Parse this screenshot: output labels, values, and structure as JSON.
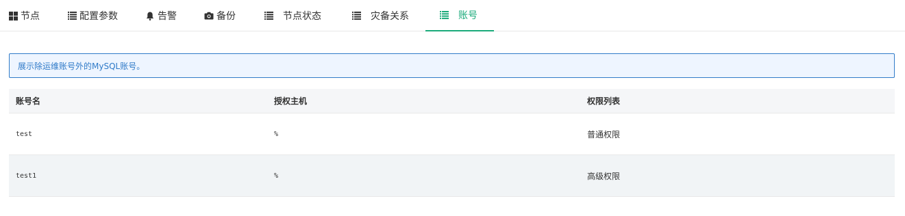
{
  "tabs": [
    {
      "label": "节点",
      "icon": "grid-icon",
      "active": false
    },
    {
      "label": "配置参数",
      "icon": "list-icon",
      "active": false
    },
    {
      "label": "告警",
      "icon": "bell-icon",
      "active": false
    },
    {
      "label": "备份",
      "icon": "camera-icon",
      "active": false
    },
    {
      "label": "节点状态",
      "icon": "list-icon",
      "active": false
    },
    {
      "label": "灾备关系",
      "icon": "list-icon",
      "active": false
    },
    {
      "label": "账号",
      "icon": "list-icon",
      "active": true
    }
  ],
  "notice": "展示除运维账号外的MySQL账号。",
  "table": {
    "headers": [
      "账号名",
      "授权主机",
      "权限列表"
    ],
    "rows": [
      {
        "account": "test",
        "host": "%",
        "privileges": "普通权限"
      },
      {
        "account": "test1",
        "host": "%",
        "privileges": "高级权限"
      }
    ]
  },
  "colors": {
    "accent": "#1aaa7a",
    "info": "#2f7ac8",
    "info_bg": "#eef5ff"
  }
}
